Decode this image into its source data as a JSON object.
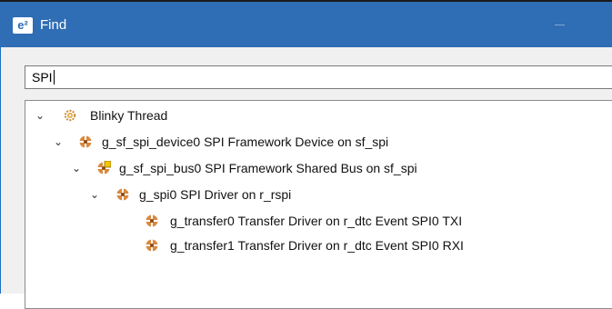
{
  "window": {
    "app_badge": "e²",
    "title": "Find"
  },
  "search": {
    "value": "SPI",
    "placeholder": ""
  },
  "tree": {
    "nodes": [
      {
        "label": "Blinky Thread",
        "icon": "gear-icon",
        "expanded": true
      },
      {
        "label": "g_sf_spi_device0 SPI Framework Device on sf_spi",
        "icon": "module-icon",
        "expanded": true
      },
      {
        "label": "g_sf_spi_bus0 SPI Framework Shared Bus on sf_spi",
        "icon": "module-warning-icon",
        "expanded": true
      },
      {
        "label": "g_spi0 SPI Driver on r_rspi",
        "icon": "module-icon",
        "expanded": true
      },
      {
        "label": "g_transfer0 Transfer Driver on r_dtc Event SPI0 TXI",
        "icon": "module-icon",
        "expanded": false
      },
      {
        "label": "g_transfer1 Transfer Driver on r_dtc Event SPI0 RXI",
        "icon": "module-icon",
        "expanded": false
      }
    ]
  },
  "colors": {
    "titlebar": "#2f6db4",
    "window_bg": "#f0f0f0",
    "module_icon": "#b5651d"
  }
}
